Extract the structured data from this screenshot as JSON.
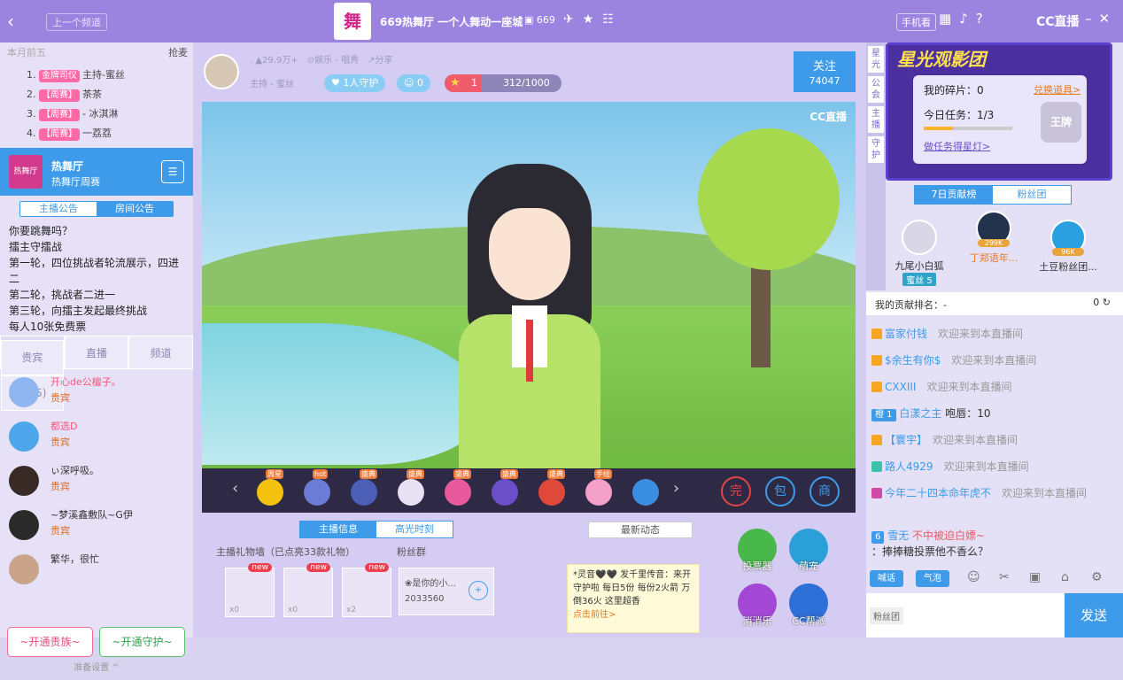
{
  "topbar": {
    "prev_channel": "上一个频道",
    "logo_text": "舞",
    "title": "669热舞厅 一个人舞动一座城",
    "room_id": "669",
    "mobile_watch": "手机看",
    "cc_logo": "CC直播"
  },
  "left": {
    "rank_header": "本月前五",
    "grab": "抢麦",
    "rank_items": [
      {
        "num": "1.",
        "badge": "金牌司仪",
        "text": "主持-蜜丝"
      },
      {
        "num": "2.",
        "badge": "【周赛】",
        "text": "茶茶"
      },
      {
        "num": "3.",
        "badge": "【周赛】",
        "text": "- 冰淇淋"
      },
      {
        "num": "4.",
        "badge": "【周赛】",
        "text": "一荔荔"
      }
    ],
    "channel_name": "热舞厅",
    "channel_sub": "热舞厅周赛",
    "channel_icon": "热舞厅",
    "notice_tabs": [
      "主播公告",
      "房间公告"
    ],
    "notice_lines": [
      "你要跳舞吗？",
      "擂主守擂战",
      "第一轮，四位挑战者轮流展示，四进二",
      "第二轮，挑战者二进一",
      "第三轮，向擂主发起最终挑战",
      "每人10张免费票"
    ],
    "list_tabs": {
      "guests": "贵宾",
      "guests_count": "(455)",
      "live": "直播",
      "channel": "频道"
    },
    "viewers": [
      {
        "name": "开心de公檀子。",
        "badge": "贵宾"
      },
      {
        "name": "都选D",
        "badge": "贵宾"
      },
      {
        "name": "ぃ深呼吸。",
        "badge": "贵宾"
      },
      {
        "name": "~梦溪鑫敷队~G伊",
        "badge": "贵宾"
      },
      {
        "name": "繁华，很忙",
        "badge": ""
      }
    ],
    "btn_noble": "开通贵族",
    "btn_guard": "开通守护",
    "settings": "准备设置"
  },
  "anchor": {
    "popularity": "29.9万+",
    "category": "娱乐 - 唱秀",
    "share": "分享",
    "tag_label": "主持 - 蜜丝",
    "guard": "1人守护",
    "fans": "0",
    "level": "1",
    "exp": "312/1000",
    "exp_fraction": 0.312,
    "follow": "关注",
    "follow_count": "74047",
    "watermark": "CC直播"
  },
  "gifts": [
    {
      "tag": "周星",
      "color": "#f4c20d"
    },
    {
      "tag": "hot",
      "color": "#6b7bd6"
    },
    {
      "tag": "盛典",
      "color": "#4a5fb5"
    },
    {
      "tag": "盛典",
      "color": "#e9e2f5"
    },
    {
      "tag": "盛典",
      "color": "#e85a9c"
    },
    {
      "tag": "盛典",
      "color": "#6b4fc8"
    },
    {
      "tag": "盛典",
      "color": "#e0483a"
    },
    {
      "tag": "手绘",
      "color": "#f3a0c8"
    },
    {
      "tag": "",
      "color": "#3a8ee0"
    }
  ],
  "gift_right_icons": [
    "完",
    "包",
    "商"
  ],
  "info": {
    "tabs": [
      "主播信息",
      "高光时刻"
    ],
    "gift_wall": "主播礼物墙（已点亮33款礼物）",
    "fan_group": "粉丝群",
    "wall_items": [
      {
        "new": "new",
        "count": "x0"
      },
      {
        "new": "new",
        "count": "x0"
      },
      {
        "new": "new",
        "count": "x2"
      }
    ],
    "fan_name": "❀是你的小...",
    "fan_id": "2033560",
    "news_button": "最新动态",
    "news_text": "*灵音🖤🖤 发千里传音：来开守护啦 每日5份 每份2火箭 万倒36火 这里超香",
    "news_link": "点击前往>"
  },
  "actions": [
    {
      "label": "投票器",
      "color": "#48b84a"
    },
    {
      "label": "萌宠",
      "color": "#2a9fd8"
    },
    {
      "label": "消消乐",
      "color": "#a248d4"
    },
    {
      "label": "CC帮派",
      "color": "#2f6fd8"
    }
  ],
  "right": {
    "side_tabs": [
      "星光",
      "公会",
      "主播",
      "守护"
    ],
    "banner_title": "星光观影团",
    "fragments": "我的碎片：0",
    "exchange": "兑换道具>",
    "task": "今日任务：1/3",
    "task_fraction": 0.333,
    "do_task": "做任务得星灯>",
    "king": "王牌",
    "rank_tabs": [
      "7日贡献榜",
      "粉丝团"
    ],
    "top3": [
      {
        "name": "九尾小白狐",
        "score": "",
        "badge": "蜜丝 5",
        "color": "#d9d6e6"
      },
      {
        "name": "丁郑语年...",
        "score": "299K",
        "badge": "",
        "color": "#23334d"
      },
      {
        "name": "土豆粉丝团...",
        "score": "96K",
        "badge": "",
        "color": "#2aa0e0"
      }
    ],
    "my_rank_label": "我的贡献排名：-",
    "my_rank_value": "0",
    "messages": [
      {
        "user": "富家付钱",
        "text": "欢迎来到本直播间"
      },
      {
        "user": "$余生有你$",
        "text": "欢迎来到本直播间"
      },
      {
        "user": "CXXIII",
        "text": "欢迎来到本直播间"
      },
      {
        "user": "白漾之主",
        "text": "咆唇：10"
      },
      {
        "user": "【寰宇】",
        "text": "欢迎来到本直播间"
      },
      {
        "user": "路人4929",
        "text": "欢迎来到本直播间"
      },
      {
        "user": "今年二十四本命年虎不",
        "text": "欢迎来到本直播间"
      },
      {
        "user": "雪无",
        "text": "不中被迫白嫖~"
      },
      {
        "user": "",
        "text": "：捧捧糖投票他不香么？"
      }
    ],
    "tool_pills": [
      "喊话",
      "气泡"
    ],
    "fan_group_btn": "粉丝团",
    "send": "发送"
  }
}
